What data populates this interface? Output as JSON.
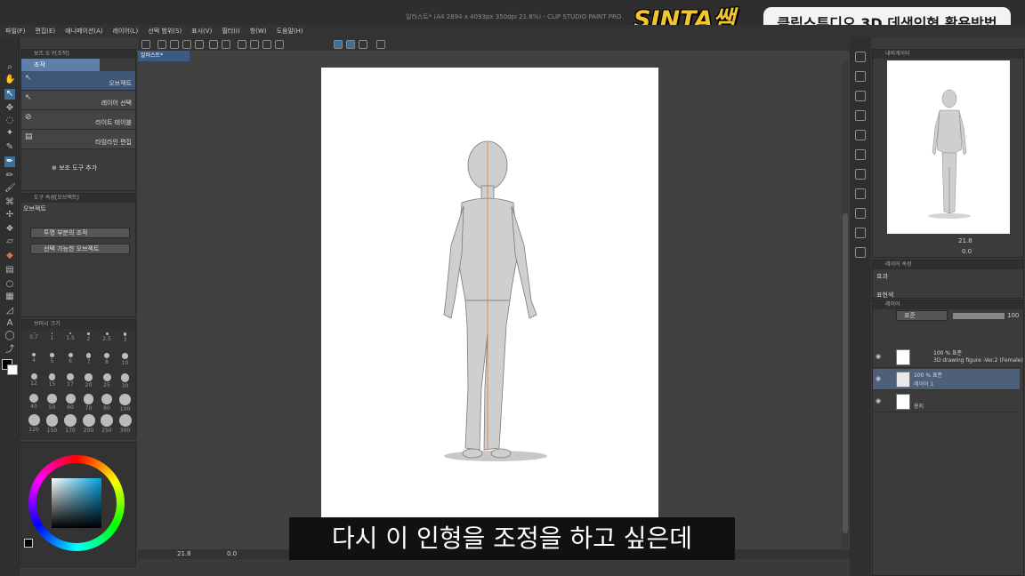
{
  "window": {
    "title": "일러스트* (A4 2894 x 4093px 350dpi 21.8%) - CLIP STUDIO PAINT PRO"
  },
  "menu": [
    "파일(F)",
    "편집(E)",
    "애니메이션(A)",
    "레이어(L)",
    "선택 범위(S)",
    "표시(V)",
    "필터(I)",
    "창(W)",
    "도움말(H)"
  ],
  "brand": {
    "logo_text": "SINTA쌤",
    "badge_text": "클립스튜디오 3D 데생인형 활용방법",
    "logo_color": "#f2c530"
  },
  "subtool_panel": {
    "header": "보조 도구[조작]",
    "group": "조작",
    "items": [
      {
        "label": "오브젝트",
        "icon": "object-icon"
      },
      {
        "label": "레이어 선택",
        "icon": "layer-select-icon"
      },
      {
        "label": "라이트 테이블",
        "icon": "light-table-icon"
      },
      {
        "label": "타임라인 편집",
        "icon": "timeline-icon"
      }
    ],
    "add_label": "보조 도구 추가"
  },
  "tool_property": {
    "header": "도구 속성[오브젝트]",
    "title": "오브젝트",
    "dropdown1": "투명 부분의 조작",
    "dropdown2": "선택 가능한 오브젝트"
  },
  "brush_size": {
    "header": "브러시 크기",
    "sizes": [
      "0.7",
      "1",
      "1.5",
      "2",
      "2.5",
      "3",
      "4",
      "5",
      "6",
      "7",
      "8",
      "10",
      "12",
      "15",
      "17",
      "20",
      "25",
      "30",
      "40",
      "50",
      "60",
      "70",
      "80",
      "100",
      "120",
      "150",
      "170",
      "200",
      "250",
      "300"
    ]
  },
  "document": {
    "tab": "일러스트*",
    "zoom": "21.8",
    "rotation": "0.0"
  },
  "subtitle": "다시 이 인형을 조정을 하고 싶은데",
  "navigator": {
    "header": "내비게이터",
    "zoom": "21.8",
    "angle": "0.0"
  },
  "layer_property": {
    "header": "레이어 속성",
    "effect_label": "효과",
    "expression_label": "표현색"
  },
  "layers": {
    "header": "레이어",
    "blend_mode": "표준",
    "opacity": "100",
    "items": [
      {
        "name": "100 % 표준",
        "sub": "3D drawing figure -Ver.2 (Female)"
      },
      {
        "name": "100 % 표준",
        "sub": "레이어 1"
      },
      {
        "name": "",
        "sub": "용지"
      }
    ]
  }
}
